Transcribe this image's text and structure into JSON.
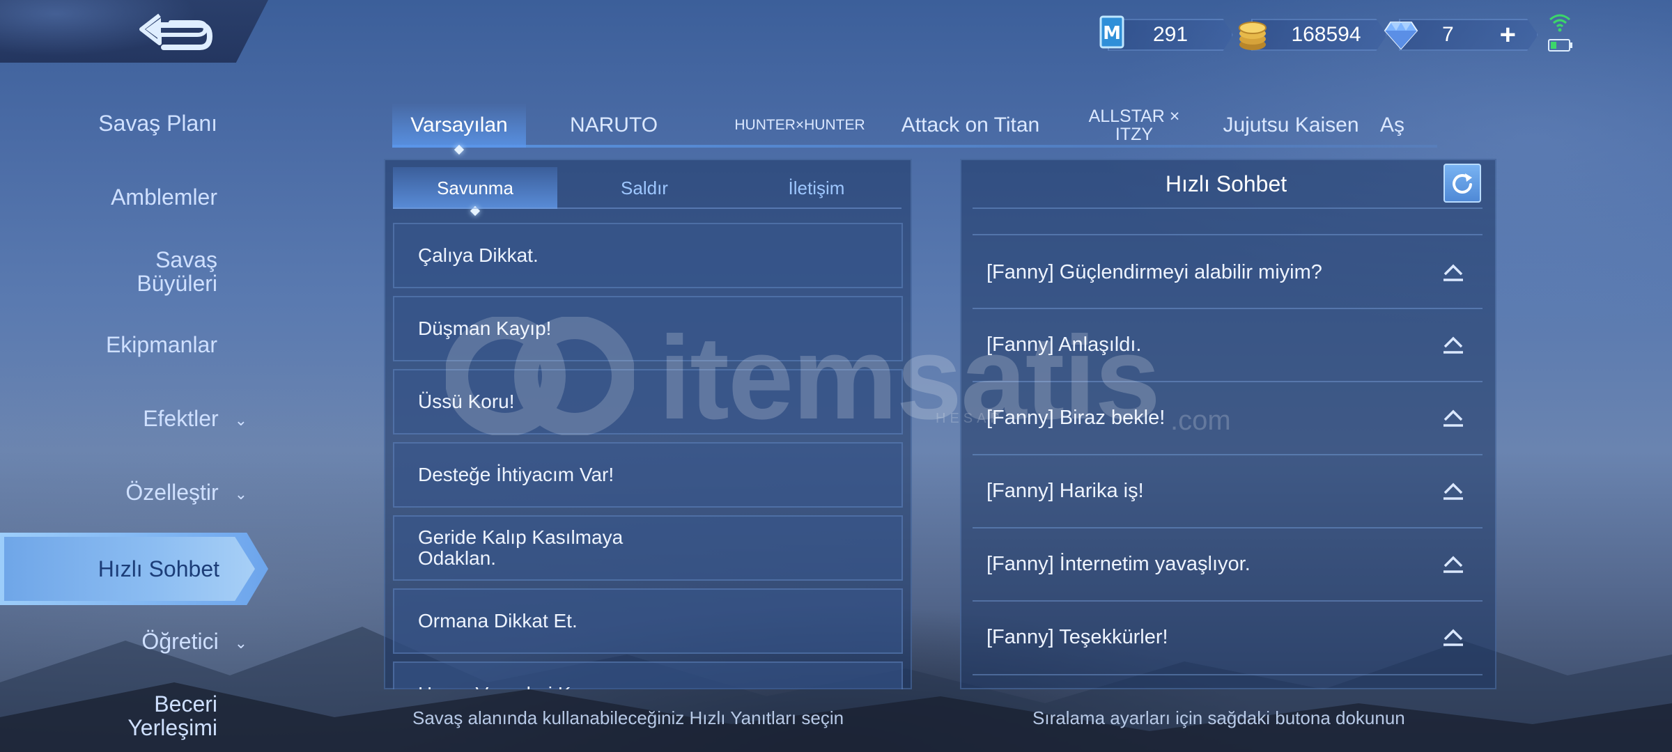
{
  "currency": {
    "badge_value": "291",
    "gold_value": "168594",
    "diamond_value": "7",
    "add_label": "+"
  },
  "sidebar": {
    "items": [
      {
        "label": "Savaş Planı"
      },
      {
        "label": "Amblemler"
      },
      {
        "label": "Savaş Büyüleri"
      },
      {
        "label": "Ekipmanlar"
      },
      {
        "label": "Efektler"
      },
      {
        "label": "Özelleştir"
      },
      {
        "label": "Hızlı Sohbet"
      },
      {
        "label": "Öğretici"
      },
      {
        "label": "Beceri Yerleşimi"
      }
    ],
    "active_index": 6
  },
  "tabs": [
    {
      "label": "Varsayılan"
    },
    {
      "label": "NARUTO"
    },
    {
      "label": "HUNTER×HUNTER"
    },
    {
      "label": "Attack on Titan"
    },
    {
      "label": "ALLSTAR × ITZY"
    },
    {
      "label": "Jujutsu Kaisen"
    },
    {
      "label": "Aş"
    }
  ],
  "subtabs": [
    {
      "label": "Savunma"
    },
    {
      "label": "Saldır"
    },
    {
      "label": "İletişim"
    }
  ],
  "phrases": [
    {
      "label": "Çalıya Dikkat."
    },
    {
      "label": "Düşman Kayıp!"
    },
    {
      "label": "Üssü Koru!"
    },
    {
      "label": "Desteğe İhtiyacım Var!"
    },
    {
      "label": "Geride Kalıp Kasılmaya Odaklan."
    },
    {
      "label": "Ormana Dikkat Et."
    },
    {
      "label": "Hasar Verenleri Koru"
    }
  ],
  "quick_chat": {
    "title": "Hızlı Sohbet",
    "items": [
      {
        "label": "[Fanny] Güçlendirmeyi alabilir miyim?"
      },
      {
        "label": "[Fanny] Anlaşıldı."
      },
      {
        "label": "[Fanny] Biraz bekle!"
      },
      {
        "label": "[Fanny] Harika iş!"
      },
      {
        "label": "[Fanny] İnternetim yavaşlıyor."
      },
      {
        "label": "[Fanny] Teşekkürler!"
      }
    ]
  },
  "hints": {
    "left": "Savaş alanında kullanabileceğiniz Hızlı Yanıtları seçin",
    "right": "Sıralama ayarları için sağdaki butona dokunun"
  },
  "watermark": {
    "brand": "itemsatis",
    "sub": "HESAP",
    "domain": ".com"
  },
  "colors": {
    "accent": "#6fa6e8",
    "text_light": "#eef4ff",
    "tab_text": "#9ec7ff"
  }
}
